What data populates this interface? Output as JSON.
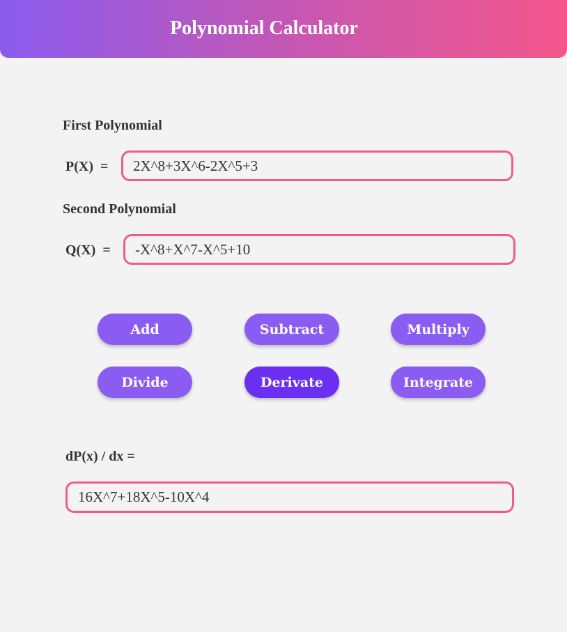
{
  "header": {
    "title": "Polynomial Calculator"
  },
  "first": {
    "section_label": "First Polynomial",
    "row_label": "P(X)  =",
    "value": "2X^8+3X^6-2X^5+3"
  },
  "second": {
    "section_label": "Second Polynomial",
    "row_label": "Q(X)  =",
    "value": "-X^8+X^7-X^5+10"
  },
  "buttons": {
    "add": "Add",
    "subtract": "Subtract",
    "multiply": "Multiply",
    "divide": "Divide",
    "derivate": "Derivate",
    "integrate": "Integrate",
    "active": "derivate"
  },
  "result": {
    "label": "dP(x) / dx =",
    "value": "16X^7+18X^5-10X^4"
  },
  "colors": {
    "header_gradient": [
      "#8b5cf0",
      "#c457b4",
      "#f4578a"
    ],
    "accent_border": "#ef5c8c",
    "button": "#8a5cf2",
    "button_active": "#6a2ff0",
    "background": "#f3f3f3"
  }
}
